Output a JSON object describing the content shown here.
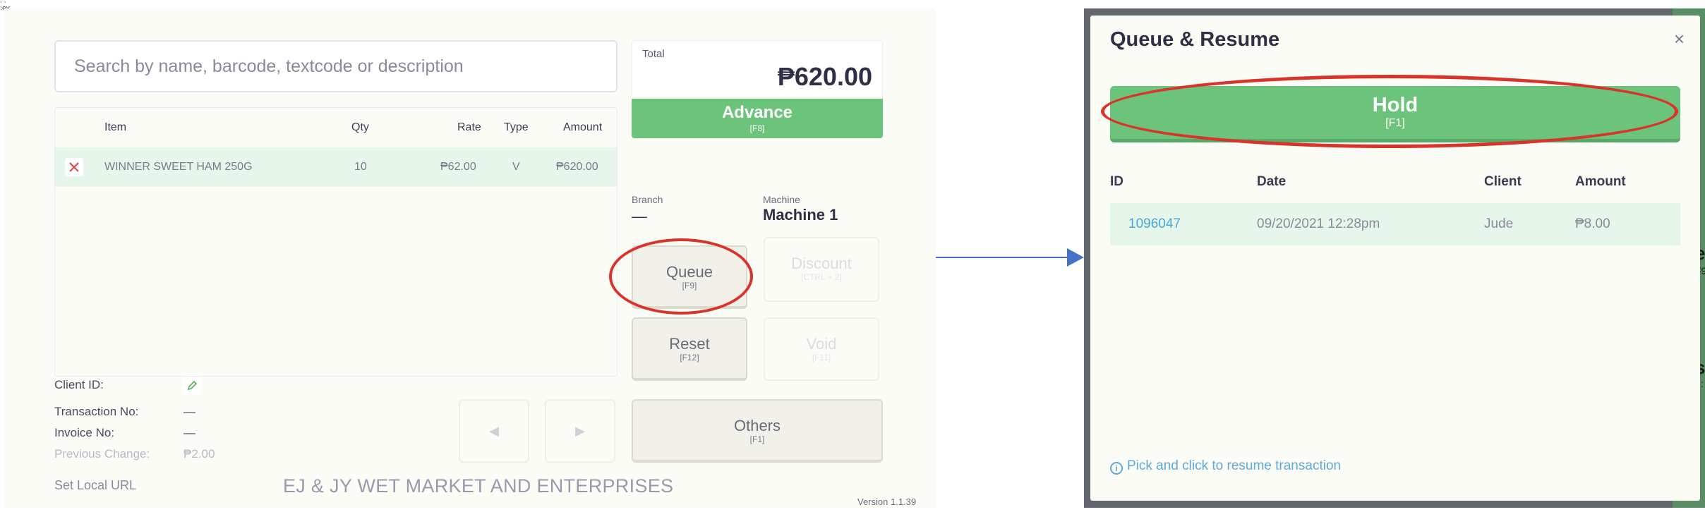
{
  "corner_mark": "· ·\n:ev",
  "pos": {
    "search_placeholder": "Search by name, barcode, textcode or description",
    "table": {
      "headers": [
        "Item",
        "Qty",
        "Rate",
        "Type",
        "Amount"
      ],
      "rows": [
        {
          "item": "WINNER SWEET HAM 250G",
          "qty": "10",
          "rate": "₱62.00",
          "type": "V",
          "amount": "₱620.00"
        }
      ]
    },
    "total_label": "Total",
    "total_value": "₱620.00",
    "advance": {
      "label": "Advance",
      "key": "[F8]"
    },
    "branch_label": "Branch",
    "branch_value": "—",
    "machine_label": "Machine",
    "machine_value": "Machine 1",
    "buttons": {
      "queue": {
        "label": "Queue",
        "key": "[F9]"
      },
      "discount": {
        "label": "Discount",
        "key": "[CTRL + 2]"
      },
      "reset": {
        "label": "Reset",
        "key": "[F12]"
      },
      "void": {
        "label": "Void",
        "key": "[F11]"
      },
      "others": {
        "label": "Others",
        "key": "[F1]"
      }
    },
    "prev_icon": "◀",
    "next_icon": "▶",
    "info": {
      "client_id_label": "Client ID:",
      "transaction_no_label": "Transaction No:",
      "transaction_no_value": "—",
      "invoice_no_label": "Invoice No:",
      "invoice_no_value": "—",
      "previous_change_label": "Previous Change:",
      "previous_change_value": "₱2.00"
    },
    "set_local_url": "Set Local URL",
    "company": "EJ & JY WET MARKET AND ENTERPRISES",
    "version": "Version 1.1.39 (V1)"
  },
  "modal": {
    "title": "Queue & Resume",
    "close": "×",
    "hold": {
      "label": "Hold",
      "key": "[F1]"
    },
    "headers": [
      "ID",
      "Date",
      "Client",
      "Amount"
    ],
    "rows": [
      {
        "id": "1096047",
        "date": "09/20/2021 12:28pm",
        "client": "Jude",
        "amount": "₱8.00"
      }
    ],
    "hint": "Pick and click to resume transaction"
  },
  "background_peek": {
    "letter_1": "e",
    "sub_1": "F9",
    "letter_2": "s",
    "sub_2": "1:"
  },
  "colors": {
    "green": "#6cc47c",
    "highlight_ring": "#d9342a",
    "arrow": "#4472c4",
    "link": "#4aa5d8"
  },
  "icons": {
    "remove": "close-icon",
    "edit": "pencil-icon",
    "info": "info-icon",
    "arrow": "right-arrow-icon"
  }
}
